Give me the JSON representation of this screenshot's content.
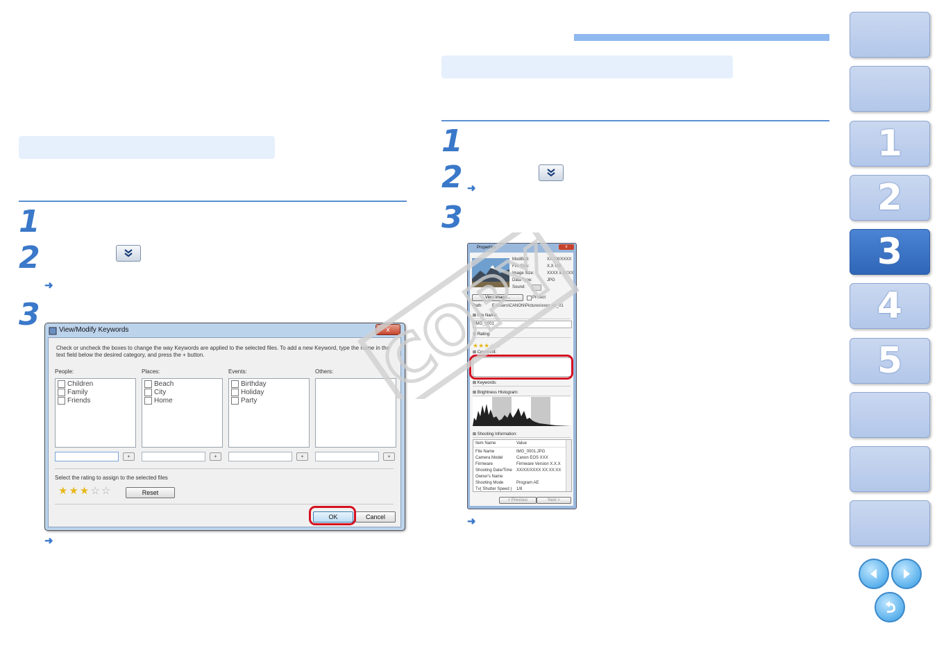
{
  "tabs": [
    "",
    "",
    "1",
    "2",
    "3",
    "4",
    "5",
    "",
    "",
    ""
  ],
  "active_tab": "3",
  "left": {
    "steps": [
      "1",
      "2",
      "3"
    ]
  },
  "right": {
    "steps": [
      "1",
      "2",
      "3"
    ]
  },
  "kw_dialog": {
    "title": "View/Modify Keywords",
    "close": "x",
    "instructions_line1": "Check or uncheck the boxes to change the way Keywords are applied to the selected files. To add a new Keyword, type the name in the",
    "instructions_line2": "text field below the desired category, and press the + button.",
    "categories": [
      {
        "label": "People:",
        "items": [
          "Children",
          "Family",
          "Friends"
        ]
      },
      {
        "label": "Places:",
        "items": [
          "Beach",
          "City",
          "Home"
        ]
      },
      {
        "label": "Events:",
        "items": [
          "Birthday",
          "Holiday",
          "Party"
        ]
      },
      {
        "label": "Others:",
        "items": []
      }
    ],
    "plus": "+",
    "rating_label": "Select the rating to assign to the selected files",
    "rating": 3,
    "rating_max": 5,
    "reset": "Reset",
    "ok": "OK",
    "cancel": "Cancel"
  },
  "prop_dialog": {
    "title": "Properties",
    "close": "x",
    "info_labels": [
      "Modified:",
      "File Size:",
      "Image Size:",
      "Data Type:",
      "Sound:"
    ],
    "info_values": [
      "XX/XX/XXXX",
      "X.X MB",
      "XXXX x XXXX",
      "JPG",
      ""
    ],
    "view_image": "View Image...",
    "protect": "Protect",
    "path_label": "Path:",
    "path_value": "E:\\Users\\CANON\\Pictures\\xxxx_xx_01",
    "file_name_hdr": "File Name:",
    "file_name_value": "IMG_0001",
    "rating_hdr": "Rating:",
    "rating": 3,
    "comment_hdr": "Comment:",
    "keywords_hdr": "Keywords:",
    "histogram_hdr": "Brightness Histogram:",
    "shooting_hdr": "Shooting Information:",
    "table_headers": [
      "Item Name",
      "Value"
    ],
    "table_rows": [
      [
        "File Name",
        "IMG_0001.JPG"
      ],
      [
        "Camera Model",
        "Canon EOS XXX"
      ],
      [
        "Firmware",
        "Firmware Version X.X.X"
      ],
      [
        "Shooting Date/Time",
        "XX/XX/XXXX XX:XX:XX"
      ],
      [
        "Owner's Name",
        ""
      ],
      [
        "Shooting Mode",
        "Program AE"
      ],
      [
        "Tv( Shutter Speed )",
        "1/8"
      ]
    ],
    "prev": "< Previous",
    "next": "Next >"
  },
  "watermark": "COPY",
  "colors": {
    "accent": "#3a78c9",
    "band": "#e6f0fc",
    "highlight": "#d51020"
  }
}
